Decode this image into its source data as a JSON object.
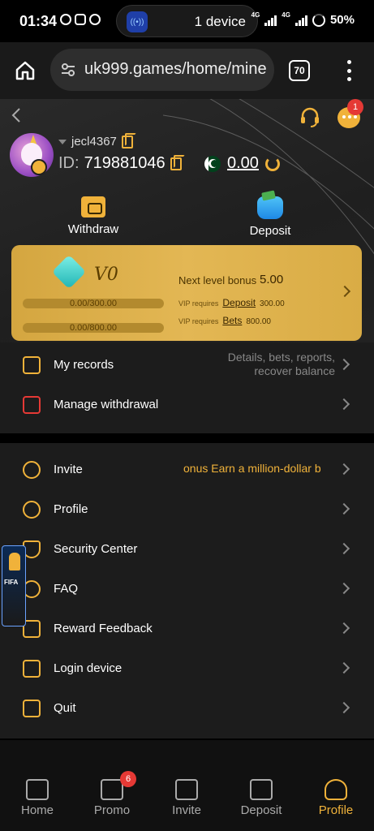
{
  "status_bar": {
    "time": "01:34",
    "pill_text": "1 device",
    "net1": "4G",
    "net2": "4G",
    "battery": "50%"
  },
  "browser": {
    "url": "uk999.games/home/mine",
    "tab_count": "70"
  },
  "header": {
    "username": "jecl4367",
    "id_label": "ID:",
    "id_value": "719881046",
    "balance": "0.00",
    "message_count": "1"
  },
  "actions": {
    "withdraw": "Withdraw",
    "deposit": "Deposit"
  },
  "vip": {
    "level": "V0",
    "progress1": "0.00/300.00",
    "progress2": "0.00/800.00",
    "next_level_label": "Next level bonus",
    "next_level_value": "5.00",
    "req_prefix": "VIP requires",
    "deposit_link": "Deposit",
    "deposit_value": "300.00",
    "bets_link": "Bets",
    "bets_value": "800.00"
  },
  "menu1": [
    {
      "label": "My records",
      "sub": "Details, bets, reports, recover balance"
    },
    {
      "label": "Manage withdrawal"
    }
  ],
  "menu2": [
    {
      "label": "Invite",
      "marquee": "onus  Earn a million-dollar b"
    },
    {
      "label": "Profile"
    },
    {
      "label": "Security Center"
    },
    {
      "label": "FAQ"
    },
    {
      "label": "Reward Feedback"
    },
    {
      "label": "Login device"
    },
    {
      "label": "Quit"
    }
  ],
  "floating_banner": "FIFA",
  "bottom_nav": [
    {
      "label": "Home"
    },
    {
      "label": "Promo",
      "badge": "6"
    },
    {
      "label": "Invite"
    },
    {
      "label": "Deposit"
    },
    {
      "label": "Profile"
    }
  ],
  "colors": {
    "accent": "#f0b23a",
    "vip_card": "#e3b754",
    "badge": "#e53935"
  }
}
